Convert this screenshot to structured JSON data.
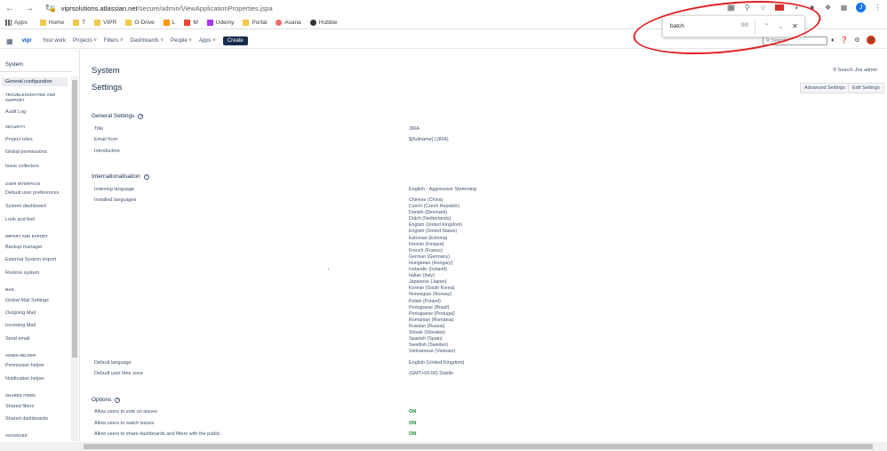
{
  "browser": {
    "url_host": "viprsolutions.atlassian.net",
    "url_path": "/secure/admin/ViewApplicationProperties.jspa",
    "profile_initial": "J"
  },
  "bookmarks": [
    "Apps",
    "Home",
    "T",
    "VIPR",
    "G-Drive",
    "L",
    "M",
    "Udemy",
    "Portal",
    "Asana",
    "Hubble"
  ],
  "find": {
    "query": "batch",
    "count": "0/0"
  },
  "jira_header": {
    "logo": "vipr",
    "your_work": "Your work",
    "projects": "Projects",
    "filters": "Filters",
    "dashboards": "Dashboards",
    "people": "People",
    "apps": "Apps",
    "create": "Create",
    "search_placeholder": "Search",
    "user_initial": "JP"
  },
  "sidebar": {
    "title": "System",
    "items": [
      {
        "type": "item",
        "label": "General configuration",
        "active": true
      },
      {
        "type": "head",
        "label": "TROUBLESHOOTING AND SUPPORT"
      },
      {
        "type": "item",
        "label": "Audit Log"
      },
      {
        "type": "head",
        "label": "SECURITY"
      },
      {
        "type": "item",
        "label": "Project roles"
      },
      {
        "type": "item",
        "label": "Global permissions"
      },
      {
        "type": "item",
        "label": "Issue collectors"
      },
      {
        "type": "head",
        "label": "USER INTERFACE"
      },
      {
        "type": "item",
        "label": "Default user preferences"
      },
      {
        "type": "item",
        "label": "System dashboard"
      },
      {
        "type": "item",
        "label": "Look and feel"
      },
      {
        "type": "head",
        "label": "IMPORT AND EXPORT"
      },
      {
        "type": "item",
        "label": "Backup manager"
      },
      {
        "type": "item",
        "label": "External System Import"
      },
      {
        "type": "item",
        "label": "Restore system"
      },
      {
        "type": "head",
        "label": "MAIL"
      },
      {
        "type": "item",
        "label": "Global Mail Settings"
      },
      {
        "type": "item",
        "label": "Outgoing Mail"
      },
      {
        "type": "item",
        "label": "Incoming Mail"
      },
      {
        "type": "item",
        "label": "Send email"
      },
      {
        "type": "head",
        "label": "ADMIN HELPER"
      },
      {
        "type": "item",
        "label": "Permission helper"
      },
      {
        "type": "item",
        "label": "Notification helper"
      },
      {
        "type": "head",
        "label": "SHARED ITEMS"
      },
      {
        "type": "item",
        "label": "Shared filters"
      },
      {
        "type": "item",
        "label": "Shared dashboards"
      },
      {
        "type": "head",
        "label": "ADVANCED"
      }
    ]
  },
  "main": {
    "system_heading": "System",
    "settings_heading": "Settings",
    "search_admin": "Search Jira admin",
    "advanced_settings": "Advanced Settings",
    "edit_settings": "Edit Settings",
    "general": {
      "title": "General Settings",
      "rows": [
        {
          "label": "Title",
          "value": "JIRA"
        },
        {
          "label": "Email from",
          "value": "${fullname} (JIRA)"
        },
        {
          "label": "Introduction",
          "value": ""
        }
      ]
    },
    "i18n": {
      "title": "Internationalisation",
      "indexing_label": "Indexing language",
      "indexing_value": "English - Aggressive Stemming",
      "installed_label": "Installed languages",
      "languages": [
        "Chinese (China)",
        "Czech (Czech Republic)",
        "Danish (Denmark)",
        "Dutch (Netherlands)",
        "English (United Kingdom)",
        "English (United States)",
        "Estonian (Estonia)",
        "Finnish (Finland)",
        "French (France)",
        "German (Germany)",
        "Hungarian (Hungary)",
        "Icelandic (Iceland)",
        "Italian (Italy)",
        "Japanese (Japan)",
        "Korean (South Korea)",
        "Norwegian (Norway)",
        "Polish (Poland)",
        "Portuguese (Brazil)",
        "Portuguese (Portugal)",
        "Romanian (Romania)",
        "Russian (Russia)",
        "Slovak (Slovakia)",
        "Spanish (Spain)",
        "Swedish (Sweden)",
        "Vietnamese (Vietnam)"
      ],
      "default_language_label": "Default language",
      "default_language_value": "English (United Kingdom)",
      "timezone_label": "Default user time zone",
      "timezone_value": "(GMT+00:00) Dublin"
    },
    "options": {
      "title": "Options",
      "rows": [
        {
          "label": "Allow users to vote on issues",
          "value": "ON"
        },
        {
          "label": "Allow users to watch issues",
          "value": "ON"
        },
        {
          "label": "Allow users to share dashboards and filters with the public.",
          "value": "ON"
        }
      ]
    }
  },
  "colors": {
    "on_green": "#14892c",
    "annotation_red": "#e02020",
    "create_button": "#172b4d"
  }
}
